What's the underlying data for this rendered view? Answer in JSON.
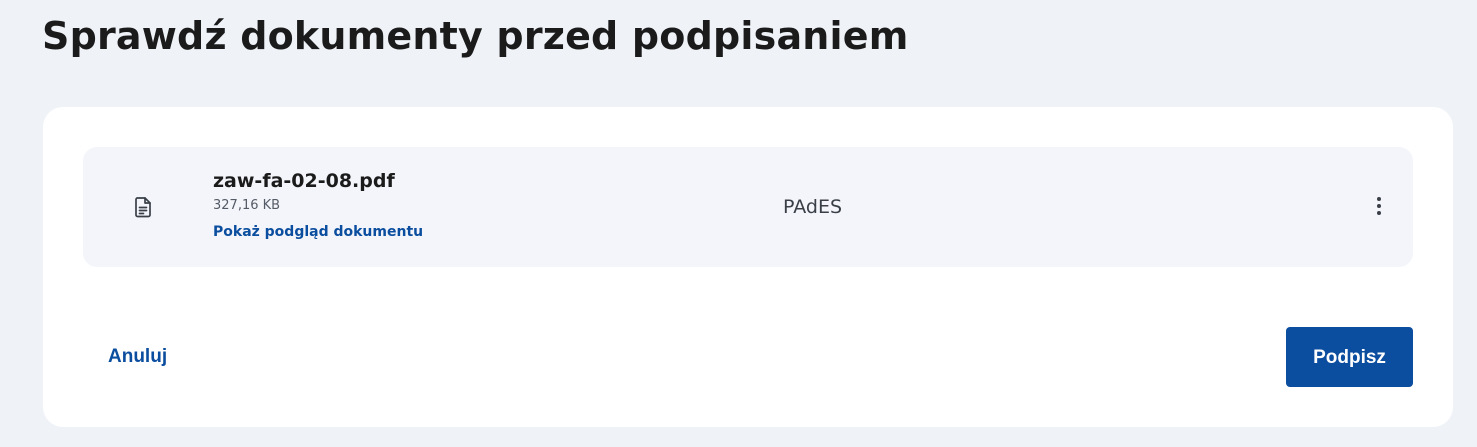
{
  "page": {
    "title": "Sprawdź dokumenty przed podpisaniem"
  },
  "document": {
    "icon": "document-icon",
    "file_name": "zaw-fa-02-08.pdf",
    "file_size": "327,16 KB",
    "preview_link": "Pokaż podgląd dokumentu",
    "signature_format": "PAdES",
    "menu_icon": "more-vertical-icon"
  },
  "actions": {
    "cancel_label": "Anuluj",
    "sign_label": "Podpisz"
  },
  "colors": {
    "background": "#eff3f8",
    "card": "#ffffff",
    "document_row": "#f3f5fa",
    "primary": "#0b4d9e",
    "text": "#1b1b1b"
  }
}
